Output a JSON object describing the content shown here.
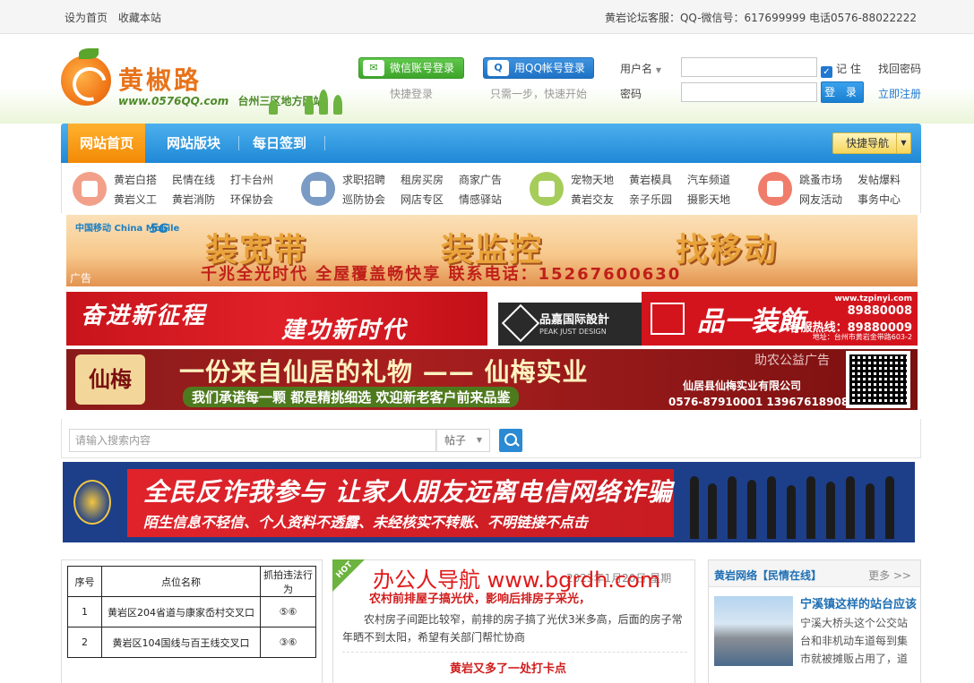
{
  "topbar": {
    "set_home": "设为首页",
    "bookmark": "收藏本站",
    "contact": "黄岩论坛客服：QQ-微信号：617699999 电话0576-88022222"
  },
  "logo": {
    "name": "黄椒路",
    "url_text": "www.0576QQ.com",
    "tagline": "台州三区地方网站"
  },
  "login": {
    "wechat_button": "微信账号登录",
    "wechat_sub": "快捷登录",
    "qq_button": "用QQ帐号登录",
    "qq_sub": "只需一步，快速开始",
    "username_label": "用户名",
    "password_label": "密码",
    "remember": "记 住",
    "submit": "登 录",
    "forgot": "找回密码",
    "register": "立即注册"
  },
  "nav": {
    "items": [
      "网站首页",
      "网站版块",
      "每日签到"
    ],
    "quick_nav": "快捷导航"
  },
  "categories": [
    {
      "icon": "chat-bubble-icon",
      "color": "#f2a08a",
      "links": [
        "黄岩白搭",
        "民情在线",
        "打卡台州",
        "黄岩义工",
        "黄岩消防",
        "环保协会"
      ]
    },
    {
      "icon": "home-icon",
      "color": "#7a9bc4",
      "links": [
        "求职招聘",
        "租房买房",
        "商家广告",
        "巡防协会",
        "网店专区",
        "情感驿站"
      ]
    },
    {
      "icon": "cart-icon",
      "color": "#a6cc5a",
      "links": [
        "宠物天地",
        "黄岩模具",
        "汽车频道",
        "黄岩交友",
        "亲子乐园",
        "摄影天地"
      ]
    },
    {
      "icon": "cup-icon",
      "color": "#f07d6b",
      "links": [
        "跳蚤市场",
        "发帖爆料",
        "网友活动",
        "事务中心"
      ]
    }
  ],
  "banners": {
    "mobile": {
      "brand": "中国移动 China Mobile",
      "g5": "5G",
      "slogans": [
        "装宽带",
        "装监控",
        "找移动"
      ],
      "line": "千兆全光时代   全屋覆盖畅快享   联系电话：15267600630",
      "ad_tag": "广告"
    },
    "red": {
      "t1": "奋进新征程",
      "t2": "建功新时代"
    },
    "pinjia": {
      "name": "品嘉国际設計",
      "en": "PEAK JUST DESIGN",
      "brand": "品一装飾",
      "web": "www.tzpinyi.com",
      "phone1": "89880008",
      "phone2": "客服热线：89880009",
      "address": "地址：台州市黄岩金带路603-2"
    },
    "xianmei": {
      "seal": "仙梅",
      "headline": "一份来自仙居的礼物 —— 仙梅实业",
      "slogan": "我们承诺每一颗 都是精挑细选  欢迎新老客户前来品鉴",
      "company": "仙居县仙梅实业有限公司",
      "phone": "0576-87910001  13967618908",
      "public": "助农公益广告"
    },
    "antifraud": {
      "headline": "全民反诈我参与  让家人朋友远离电信网络诈骗",
      "sub": "陌生信息不轻信、个人资料不透露、未经核实不转账、不明链接不点击"
    }
  },
  "search": {
    "placeholder": "请输入搜索内容",
    "type": "帖子"
  },
  "table": {
    "headers": [
      "序号",
      "点位名称",
      "抓拍违法行为"
    ],
    "rows": [
      [
        "1",
        "黄岩区204省道与康家岙村交叉口",
        "⑤⑥"
      ],
      [
        "2",
        "黄岩区104国线与百王线交叉口",
        "③⑥"
      ]
    ]
  },
  "hot": {
    "tag": "HOT",
    "watermark": "办公人导航 www.bgrdh.com",
    "date": "2023年1月20日 星期",
    "title": "农村前排屋子搞光伏，影响后排房子采光，",
    "body": "农村房子间距比较窄，前排的房子搞了光伏3米多高，后面的房子常年晒不到太阳，希望有关部门帮忙协商",
    "title2": "黄岩又多了一处打卡点"
  },
  "news": {
    "header": "黄岩网络【民情在线】",
    "more": "更多 >>",
    "title": "宁溪镇这样的站台应该",
    "text": "宁溪大桥头这个公交站台和非机动车道每到集市就被摊贩占用了，道"
  }
}
